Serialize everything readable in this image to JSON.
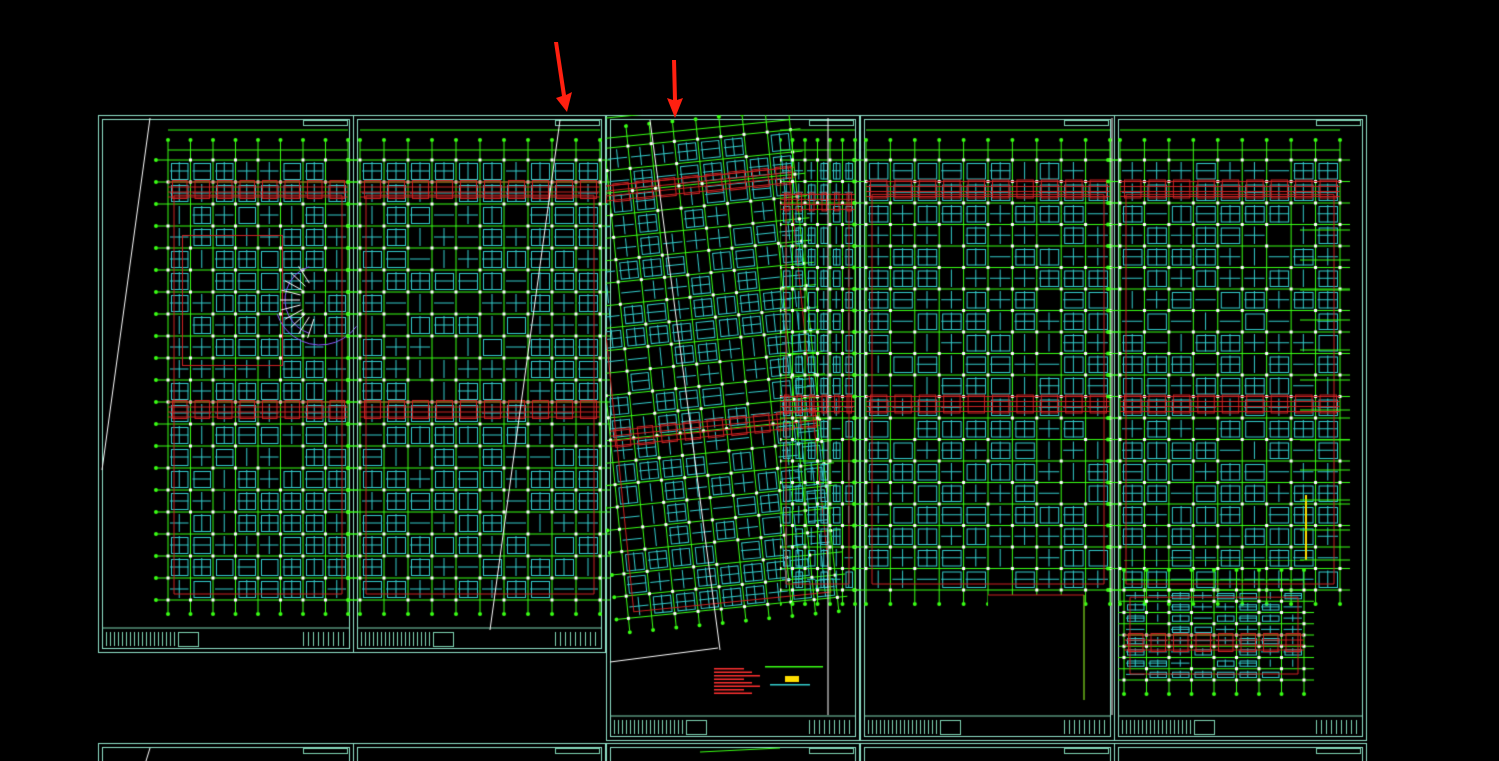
{
  "view": {
    "background": "#000000"
  },
  "palette": {
    "sheet_border": "#8fe0c8",
    "axis_grid": "#39ff14",
    "beam": "#33cccc",
    "wall": "#cc2222",
    "column": "#ffffff",
    "accent_yellow": "#ffdd00",
    "annotation_red": "#ff3030",
    "title_block": "#7fd6b5",
    "stair_purple": "#8a5cff",
    "marker": "#ff2010"
  },
  "sheets": [
    {
      "id": "sheet-1",
      "row": 1,
      "rotated": false
    },
    {
      "id": "sheet-2",
      "row": 1,
      "rotated": false
    },
    {
      "id": "sheet-3",
      "row": 1,
      "rotated": true
    },
    {
      "id": "sheet-4",
      "row": 1,
      "rotated": false
    },
    {
      "id": "sheet-5",
      "row": 1,
      "rotated": false
    }
  ],
  "markers": [
    {
      "id": "arrow-1",
      "color": "#ff2010",
      "direction": "down"
    },
    {
      "id": "arrow-2",
      "color": "#ff2010",
      "direction": "down"
    }
  ]
}
